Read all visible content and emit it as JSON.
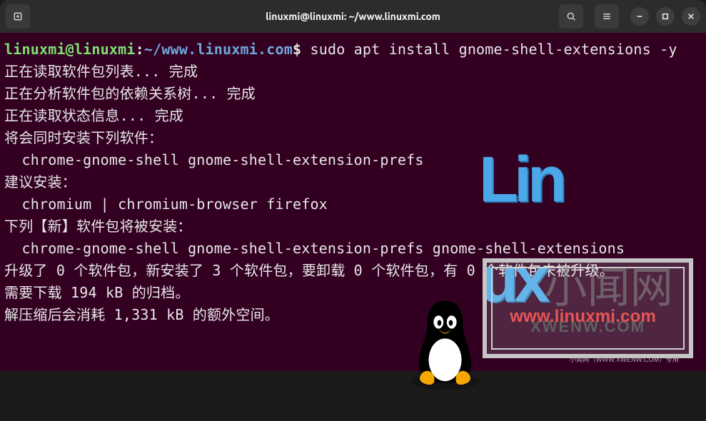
{
  "header": {
    "title": "linuxmi@linuxmi: ~/www.linuxmi.com"
  },
  "prompt": {
    "user_host": "linuxmi@linuxmi",
    "colon": ":",
    "path": "~/www.linuxmi.com",
    "dollar": "$"
  },
  "command": " sudo apt install gnome-shell-extensions -y",
  "output_lines": [
    "正在读取软件包列表... 完成",
    "正在分析软件包的依赖关系树... 完成",
    "正在读取状态信息... 完成",
    "将会同时安装下列软件：",
    "  chrome-gnome-shell gnome-shell-extension-prefs",
    "建议安装：",
    "  chromium | chromium-browser firefox",
    "下列【新】软件包将被安装：",
    "  chrome-gnome-shell gnome-shell-extension-prefs gnome-shell-extensions",
    "升级了 0 个软件包，新安装了 3 个软件包，要卸载 0 个软件包，有 0 个软件包未被升级。",
    "需要下载 194 kB 的归档。",
    "解压缩后会消耗 1,331 kB 的额外空间。"
  ],
  "watermark": {
    "big_text": "Linux",
    "cn_text": "小闻网",
    "url": "www.linuxmi.com",
    "xwenw": "XWENW.COM",
    "small": "小闻网（WWW.XWENW.COM）专用"
  }
}
